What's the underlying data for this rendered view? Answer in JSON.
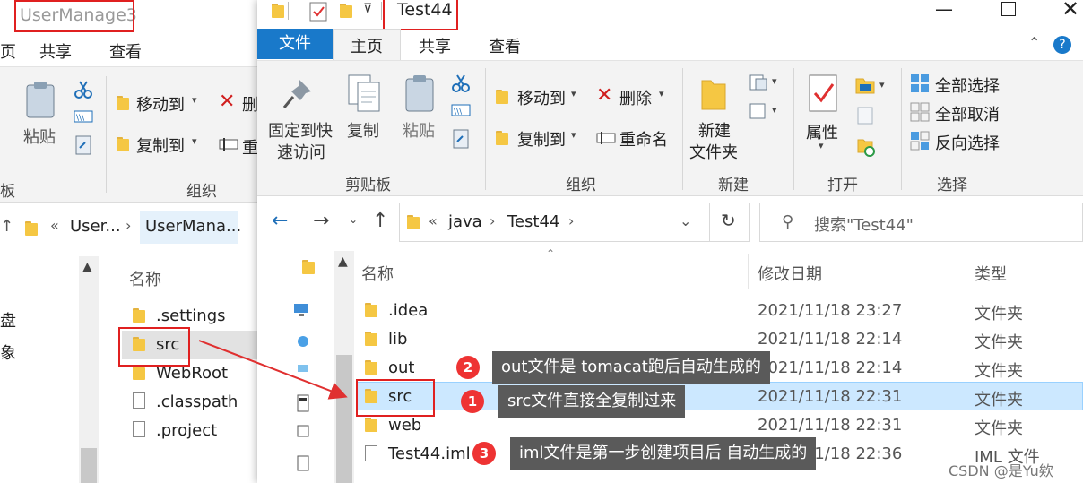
{
  "back_window": {
    "title": "UserManage3",
    "tabs": [
      "页",
      "共享",
      "查看"
    ],
    "ribbon": {
      "paste": "粘贴",
      "move_to": "移动到",
      "copy_to": "复制到",
      "delete": "删",
      "rename": "重",
      "group_clipboard": "板",
      "group_organize": "组织"
    },
    "breadcrumb": {
      "sep": "«",
      "item1": "User...",
      "item2": "UserMana..."
    },
    "nav_items": [
      "盘",
      "象"
    ],
    "column_name": "名称",
    "files": [
      {
        "name": ".settings",
        "type": "folder"
      },
      {
        "name": "src",
        "type": "folder"
      },
      {
        "name": "WebRoot",
        "type": "folder"
      },
      {
        "name": ".classpath",
        "type": "file"
      },
      {
        "name": ".project",
        "type": "file"
      }
    ]
  },
  "front_window": {
    "title": "Test44",
    "tabs": {
      "file": "文件",
      "home": "主页",
      "share": "共享",
      "view": "查看"
    },
    "ribbon": {
      "pin": "固定到快速访问",
      "pin_line1": "固定到快",
      "pin_line2": "速访问",
      "copy": "复制",
      "paste": "粘贴",
      "move_to": "移动到",
      "copy_to": "复制到",
      "delete": "删除",
      "rename": "重命名",
      "new_folder_line1": "新建",
      "new_folder_line2": "文件夹",
      "properties": "属性",
      "select_all": "全部选择",
      "select_none": "全部取消",
      "invert_select": "反向选择",
      "group_clipboard": "剪贴板",
      "group_organize": "组织",
      "group_new": "新建",
      "group_open": "打开",
      "group_select": "选择"
    },
    "address": {
      "sep": "«",
      "crumb1": "java",
      "crumb2": "Test44"
    },
    "search_placeholder": "搜索\"Test44\"",
    "columns": {
      "name": "名称",
      "date": "修改日期",
      "type": "类型"
    },
    "files": [
      {
        "name": ".idea",
        "date": "2021/11/18 23:27",
        "type": "文件夹"
      },
      {
        "name": "lib",
        "date": "2021/11/18 22:14",
        "type": "文件夹"
      },
      {
        "name": "out",
        "date": "2021/11/18 22:14",
        "type": "文件夹"
      },
      {
        "name": "src",
        "date": "2021/11/18 22:31",
        "type": "文件夹"
      },
      {
        "name": "web",
        "date": "2021/11/18 22:31",
        "type": "文件夹"
      },
      {
        "name": "Test44.iml",
        "date": "2021/11/18 22:36",
        "type": "IML 文件"
      }
    ]
  },
  "annotations": [
    {
      "num": "2",
      "text": "out文件是 tomacat跑后自动生成的"
    },
    {
      "num": "1",
      "text": "src文件直接全复制过来"
    },
    {
      "num": "3",
      "text": "iml文件是第一步创建项目后 自动生成的"
    }
  ],
  "watermark": "CSDN @是Yu欸",
  "colors": {
    "accent": "#1979ca",
    "highlight": "#cce8ff",
    "annotation": "#e02020",
    "callout_bg": "#5a5a5a"
  }
}
